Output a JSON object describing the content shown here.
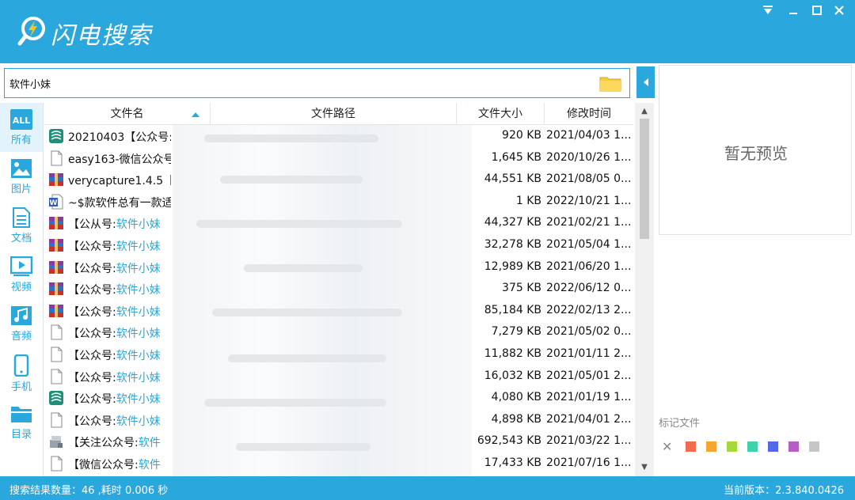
{
  "app": {
    "title": "闪电搜索",
    "window_controls": [
      "menu-icon",
      "minimize-icon",
      "maximize-icon",
      "close-icon"
    ]
  },
  "search": {
    "value": "软件小妹",
    "placeholder": ""
  },
  "sidebar": {
    "items": [
      {
        "label": "所有",
        "icon": "all-icon",
        "active": true
      },
      {
        "label": "图片",
        "icon": "image-icon"
      },
      {
        "label": "文档",
        "icon": "document-icon"
      },
      {
        "label": "视频",
        "icon": "video-icon"
      },
      {
        "label": "音频",
        "icon": "audio-icon"
      },
      {
        "label": "手机",
        "icon": "phone-icon"
      },
      {
        "label": "目录",
        "icon": "folder-icon"
      }
    ]
  },
  "table": {
    "headers": {
      "name": "文件名",
      "path": "文件路径",
      "size": "文件大小",
      "date": "修改时间"
    },
    "rows": [
      {
        "icon": "archive-icon",
        "name": "20210403【公众号:",
        "hl": "",
        "size": "920 KB",
        "date": "2021/04/03 1..."
      },
      {
        "icon": "file-icon",
        "name": "easy163-微信公众号",
        "hl": "",
        "size": "1,645 KB",
        "date": "2020/10/26 1..."
      },
      {
        "icon": "rar-icon",
        "name": "verycapture1.4.5【",
        "hl": "",
        "size": "44,551 KB",
        "date": "2021/08/05 0..."
      },
      {
        "icon": "word-icon",
        "name": "~$款软件总有一款适",
        "hl": "",
        "size": "1 KB",
        "date": "2022/10/21 1..."
      },
      {
        "icon": "rar-icon",
        "name": "【公从号:",
        "hl": "软件小妹",
        "size": "44,327 KB",
        "date": "2021/02/21 1..."
      },
      {
        "icon": "rar-icon",
        "name": "【公众号:",
        "hl": "软件小妹",
        "size": "32,278 KB",
        "date": "2021/05/04 1..."
      },
      {
        "icon": "rar-icon",
        "name": "【公众号:",
        "hl": "软件小妹",
        "size": "12,989 KB",
        "date": "2021/06/20 1..."
      },
      {
        "icon": "rar-icon",
        "name": "【公众号:",
        "hl": "软件小妹",
        "size": "375 KB",
        "date": "2022/06/12 0..."
      },
      {
        "icon": "rar-icon",
        "name": "【公众号:",
        "hl": "软件小妹",
        "size": "85,184 KB",
        "date": "2022/02/13 2..."
      },
      {
        "icon": "file-icon",
        "name": "【公众号:",
        "hl": "软件小妹",
        "size": "7,279 KB",
        "date": "2021/05/02 0..."
      },
      {
        "icon": "file-icon",
        "name": "【公众号:",
        "hl": "软件小妹",
        "size": "11,882 KB",
        "date": "2021/01/11 2..."
      },
      {
        "icon": "file-icon",
        "name": "【公众号:",
        "hl": "软件小妹",
        "size": "16,032 KB",
        "date": "2021/05/01 2..."
      },
      {
        "icon": "archive-icon",
        "name": "【公众号:",
        "hl": "软件小妹",
        "size": "4,080 KB",
        "date": "2021/01/19 1..."
      },
      {
        "icon": "file-icon",
        "name": "【公众号:",
        "hl": "软件小妹",
        "size": "4,898 KB",
        "date": "2021/04/01 2..."
      },
      {
        "icon": "exe-icon",
        "name": "【关注公众号:",
        "hl": "软件",
        "size": "692,543 KB",
        "date": "2021/03/22 1..."
      },
      {
        "icon": "file-icon",
        "name": "【微信公众号:",
        "hl": "软件",
        "size": "17,433 KB",
        "date": "2021/07/16 1..."
      }
    ]
  },
  "preview": {
    "text": "暂无预览"
  },
  "marks": {
    "label": "标记文件",
    "colors": [
      "#f26b4e",
      "#f7a531",
      "#a6d83b",
      "#3fd1a9",
      "#5368e6",
      "#b55ec4",
      "#c6c6c6"
    ]
  },
  "status": {
    "left": "搜索结果数量：46 ,耗时 0.006 秒",
    "right": "当前版本：2.3.840.0426"
  }
}
